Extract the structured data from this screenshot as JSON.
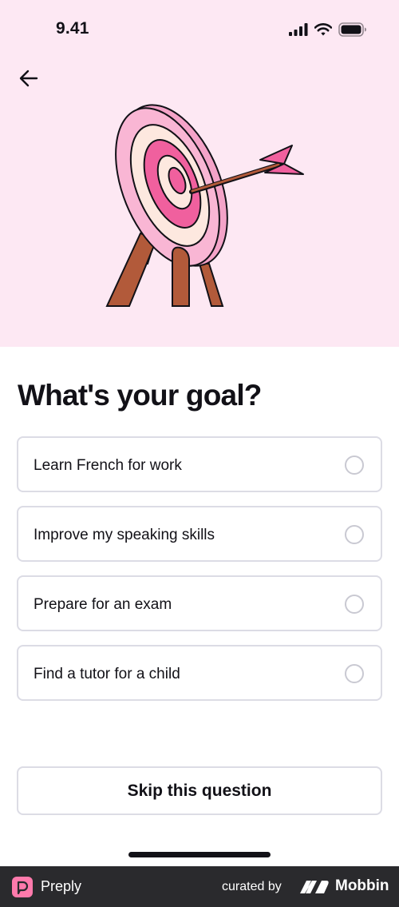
{
  "status_bar": {
    "time": "9.41"
  },
  "header": {
    "back_icon": "arrow-left-icon"
  },
  "hero": {
    "illustration": "target-with-arrow"
  },
  "question": {
    "title": "What's your goal?"
  },
  "options": [
    {
      "label": "Learn French for work",
      "selected": false
    },
    {
      "label": "Improve my speaking skills",
      "selected": false
    },
    {
      "label": "Prepare for an exam",
      "selected": false
    },
    {
      "label": "Find a tutor for a child",
      "selected": false
    }
  ],
  "skip": {
    "label": "Skip this question"
  },
  "footer": {
    "app_name": "Preply",
    "curated_by": "curated by",
    "brand": "Mobbin"
  },
  "colors": {
    "hero_background": "#fde8f3",
    "target_pink": "#f7a8cc",
    "target_center": "#f0609e",
    "footer_background": "#2a2a2d"
  }
}
